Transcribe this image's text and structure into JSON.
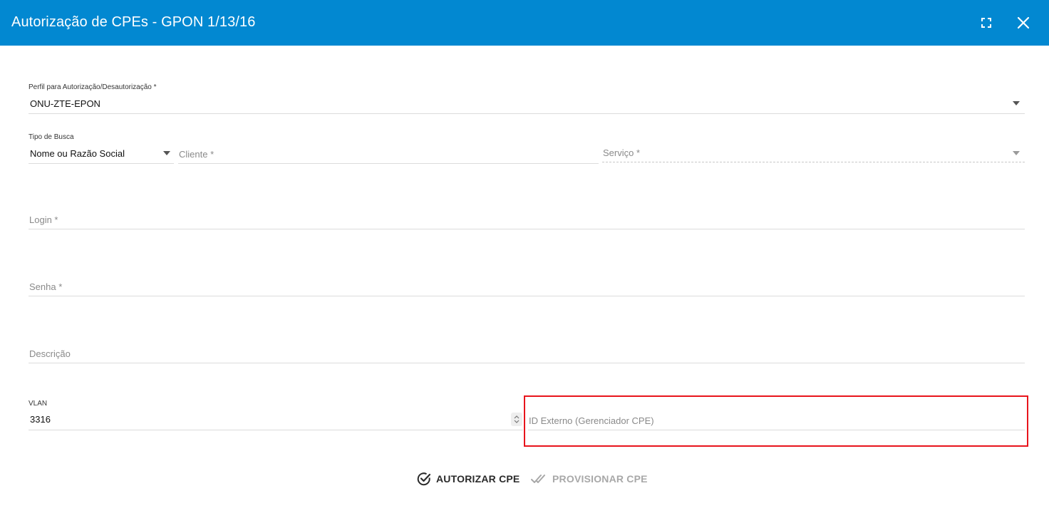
{
  "dialog": {
    "title": "Autorização de CPEs - GPON 1/13/16",
    "maximize_icon": "fullscreen-icon",
    "close_icon": "close-icon",
    "header_color": "#0288d1"
  },
  "form": {
    "perfil": {
      "label": "Perfil para Autorização/Desautorização *",
      "value": "ONU-ZTE-EPON"
    },
    "tipo_busca": {
      "label": "Tipo de Busca",
      "value": "Nome ou Razão Social"
    },
    "cliente": {
      "placeholder": "Cliente *"
    },
    "servico": {
      "placeholder": "Serviço *"
    },
    "login": {
      "placeholder": "Login *"
    },
    "senha": {
      "placeholder": "Senha *"
    },
    "descricao": {
      "placeholder": "Descrição"
    },
    "vlan": {
      "label": "VLAN",
      "value": "3316"
    },
    "id_externo": {
      "placeholder": "ID Externo (Gerenciador CPE)"
    }
  },
  "actions": {
    "autorizar": "AUTORIZAR CPE",
    "provisionar": "PROVISIONAR CPE"
  },
  "colors": {
    "highlight": "#e8141c",
    "disabled_text": "#a8a8a8"
  }
}
